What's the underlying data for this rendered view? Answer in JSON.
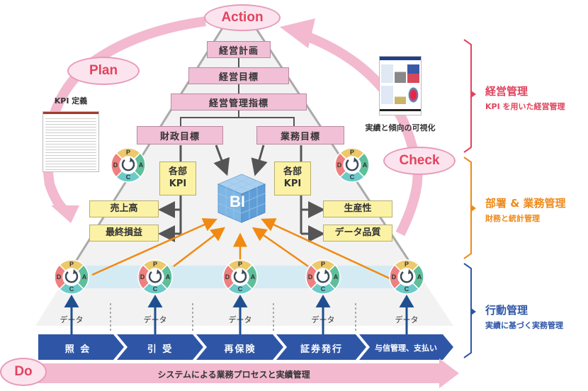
{
  "pdca_cycle": {
    "plan": "Plan",
    "do": "Do",
    "check": "Check",
    "action": "Action"
  },
  "pyramid": {
    "levels": [
      "経営計画",
      "経営目標",
      "経営管理指標"
    ],
    "financial_goal": "財政目標",
    "business_goal": "業務目標",
    "dept_kpi_left": "各部\nKPI",
    "dept_kpi_right": "各部\nKPI",
    "left_metrics": [
      "売上高",
      "最終損益"
    ],
    "right_metrics": [
      "生産性",
      "データ品質"
    ],
    "bi_label": "BI"
  },
  "pdca_wheel": {
    "p": "P",
    "d": "D",
    "c": "C",
    "a": "A"
  },
  "kpi_definition_caption": "KPI 定義",
  "visualization_caption": "実績と傾向の可視化",
  "data_label": "データ",
  "processes": [
    "照 会",
    "引 受",
    "再保険",
    "証券発行",
    "与信管理、支払い"
  ],
  "do_bar_text": "システムによる業務プロセスと実績管理",
  "management_levels": [
    {
      "title": "経営管理",
      "subtitle": "KPI を用いた経営管理",
      "color": "#e2435e"
    },
    {
      "title": "部署 & 業務管理",
      "subtitle": "財務と統計管理",
      "color": "#ee8a1a"
    },
    {
      "title": "行動管理",
      "subtitle": "実績に基づく実務管理",
      "color": "#2f56a6"
    }
  ],
  "colors": {
    "pink_cycle": "#f2b9cf",
    "process_blue": "#2f56a6",
    "orange_arrow": "#f08a12",
    "gray_line": "#666666"
  }
}
